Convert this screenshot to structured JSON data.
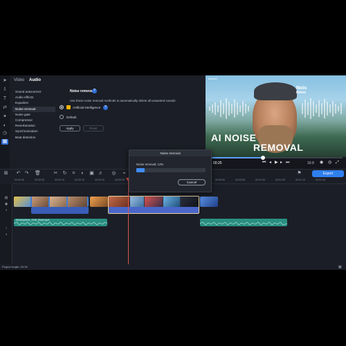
{
  "rail_icons": [
    "pointer-icon",
    "import-icon",
    "titles-icon",
    "transitions-icon",
    "filters-icon",
    "stickers-icon",
    "tools-icon"
  ],
  "panel": {
    "tabs": [
      "Video",
      "Audio"
    ],
    "active_tab": "Audio",
    "tools": [
      "Sound autocorrect",
      "Audio effects",
      "Equalizer",
      "Noise removal",
      "Noise gate",
      "Compressor",
      "Reverberation",
      "Synchronization",
      "Beat detection"
    ],
    "active_tool": "Noise removal",
    "title": "Noise removal",
    "help_icon": "?",
    "description": "Use these noise removal methods to automatically delete all unwanted sounds",
    "options": [
      {
        "label": "Artificial intelligence",
        "checked": true
      },
      {
        "label": "Default",
        "checked": false
      }
    ],
    "apply_label": "Apply",
    "reset_label": "Reset"
  },
  "preview": {
    "brand": "movavi",
    "badge_line1": "Nois",
    "badge_line2": "Remo",
    "headline_line1": "AI NOISE",
    "headline_line2": "REMOVAL",
    "timecode": "00:25",
    "zoom": "16:9",
    "progress": 0.4
  },
  "toolbar": {
    "export_label": "Export"
  },
  "ruler": {
    "labels": [
      "00:00:00",
      "00:00:05",
      "00:00:10",
      "00:00:15",
      "00:00:20",
      "00:00:25",
      "00:00:30",
      "00:00:35",
      "00:00:40",
      "00:00:45",
      "00:00:50",
      "00:00:55",
      "00:01:00",
      "00:01:05",
      "00:01:10",
      "00:01:15"
    ]
  },
  "audio_track": {
    "clip1_label": "Atmosphere_Chill_Beat.mp3",
    "clip2_label": ""
  },
  "modal": {
    "title": "Noise removal",
    "message": "Noise removal: 12%",
    "progress": 0.12,
    "cancel_label": "Cancel"
  },
  "status": {
    "project_length": "Project length: 00:39"
  },
  "colors": {
    "accent": "#2f7ff0",
    "audio_clip": "#2a8f82",
    "playhead": "#d9534f"
  }
}
